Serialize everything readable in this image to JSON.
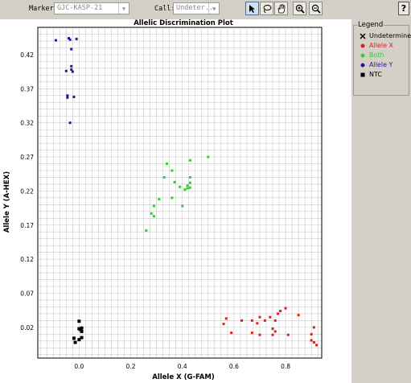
{
  "toolbar": {
    "marker_label": "Marker:",
    "marker_value": "GJC-KASP-21",
    "call_label": "Call:",
    "call_value": "Undeter...",
    "help_label": "?",
    "tools": [
      "select-arrow-icon",
      "lasso-icon",
      "pan-hand-icon",
      "zoom-in-icon",
      "zoom-out-icon"
    ]
  },
  "legend": {
    "title": "Legend",
    "items": [
      {
        "label": "Undetermined",
        "color": "#000000",
        "marker": "x"
      },
      {
        "label": "Allele X",
        "color": "#d9231f",
        "marker": "dot"
      },
      {
        "label": "Both",
        "color": "#33cc33",
        "marker": "dot"
      },
      {
        "label": "Allele Y",
        "color": "#1c1c9c",
        "marker": "dot"
      },
      {
        "label": "NTC",
        "color": "#000000",
        "marker": "square"
      }
    ]
  },
  "chart_data": {
    "type": "scatter",
    "title": "Allelic Discrimination Plot",
    "xlabel": "Allele X (G-FAM)",
    "ylabel": "Allele Y (A-HEX)",
    "xlim": [
      -0.16,
      0.94
    ],
    "ylim": [
      -0.025,
      0.46
    ],
    "x_ticks": [
      0.0,
      0.2,
      0.4,
      0.6,
      0.8
    ],
    "x_tick_labels": [
      "0.0",
      "0.2",
      "0.4",
      "0.6",
      "0.8"
    ],
    "y_ticks": [
      0.02,
      0.07,
      0.12,
      0.17,
      0.22,
      0.27,
      0.32,
      0.37,
      0.42
    ],
    "y_tick_labels": [
      "0.02",
      "0.07",
      "0.12",
      "0.17",
      "0.22",
      "0.27",
      "0.32",
      "0.37",
      "0.42"
    ],
    "grid": true,
    "series": [
      {
        "name": "Allele Y",
        "color": "#1c1c9c",
        "marker": "square",
        "points": [
          [
            -0.09,
            0.441
          ],
          [
            -0.04,
            0.444
          ],
          [
            -0.035,
            0.442
          ],
          [
            -0.01,
            0.443
          ],
          [
            -0.03,
            0.428
          ],
          [
            -0.05,
            0.396
          ],
          [
            -0.03,
            0.398
          ],
          [
            -0.025,
            0.395
          ],
          [
            -0.03,
            0.403
          ],
          [
            -0.045,
            0.36
          ],
          [
            -0.045,
            0.357
          ],
          [
            -0.02,
            0.358
          ],
          [
            -0.035,
            0.32
          ]
        ]
      },
      {
        "name": "Both",
        "color": "#33cc33",
        "marker": "square",
        "points": [
          [
            0.5,
            0.27
          ],
          [
            0.43,
            0.265
          ],
          [
            0.34,
            0.26
          ],
          [
            0.36,
            0.25
          ],
          [
            0.43,
            0.24
          ],
          [
            0.33,
            0.24
          ],
          [
            0.37,
            0.233
          ],
          [
            0.43,
            0.232
          ],
          [
            0.39,
            0.226
          ],
          [
            0.42,
            0.228
          ],
          [
            0.42,
            0.224
          ],
          [
            0.41,
            0.222
          ],
          [
            0.43,
            0.225
          ],
          [
            0.31,
            0.208
          ],
          [
            0.36,
            0.21
          ],
          [
            0.4,
            0.198
          ],
          [
            0.29,
            0.198
          ],
          [
            0.28,
            0.187
          ],
          [
            0.29,
            0.183
          ],
          [
            0.26,
            0.162
          ]
        ]
      },
      {
        "name": "Allele X",
        "color": "#d9231f",
        "marker": "square",
        "points": [
          [
            0.8,
            0.048
          ],
          [
            0.78,
            0.044
          ],
          [
            0.77,
            0.04
          ],
          [
            0.85,
            0.038
          ],
          [
            0.7,
            0.035
          ],
          [
            0.74,
            0.035
          ],
          [
            0.57,
            0.033
          ],
          [
            0.63,
            0.03
          ],
          [
            0.67,
            0.03
          ],
          [
            0.72,
            0.03
          ],
          [
            0.76,
            0.03
          ],
          [
            0.69,
            0.026
          ],
          [
            0.56,
            0.025
          ],
          [
            0.91,
            0.02
          ],
          [
            0.75,
            0.018
          ],
          [
            0.76,
            0.014
          ],
          [
            0.59,
            0.012
          ],
          [
            0.67,
            0.012
          ],
          [
            0.7,
            0.009
          ],
          [
            0.81,
            0.009
          ],
          [
            0.75,
            0.009
          ],
          [
            0.9,
            0.01
          ],
          [
            0.9,
            0.001
          ],
          [
            0.91,
            -0.002
          ],
          [
            0.92,
            -0.006
          ]
        ]
      },
      {
        "name": "NTC",
        "color": "#000000",
        "marker": "square",
        "points": [
          [
            0.0,
            0.029
          ],
          [
            0.0,
            0.018
          ],
          [
            0.01,
            0.019
          ],
          [
            0.01,
            0.014
          ],
          [
            0.005,
            0.017
          ],
          [
            -0.02,
            0.004
          ],
          [
            0.01,
            0.005
          ],
          [
            0.0,
            0.002
          ],
          [
            -0.015,
            -0.002
          ]
        ]
      }
    ]
  }
}
